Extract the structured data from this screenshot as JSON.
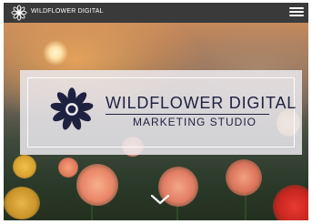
{
  "header": {
    "site_name": "WILDFLOWER DIGITAL",
    "logo_icon": "lotus-icon",
    "menu_icon": "hamburger-menu-icon"
  },
  "hero": {
    "brand_name": "WILDFLOWER DIGITAL",
    "tagline": "MARKETING STUDIO",
    "brand_logo_icon": "lotus-icon",
    "scroll_icon": "chevron-down-icon"
  },
  "colors": {
    "navbar": "#3a3a3a",
    "brand_text": "#1f2140",
    "panel": "#ebe9ee"
  }
}
